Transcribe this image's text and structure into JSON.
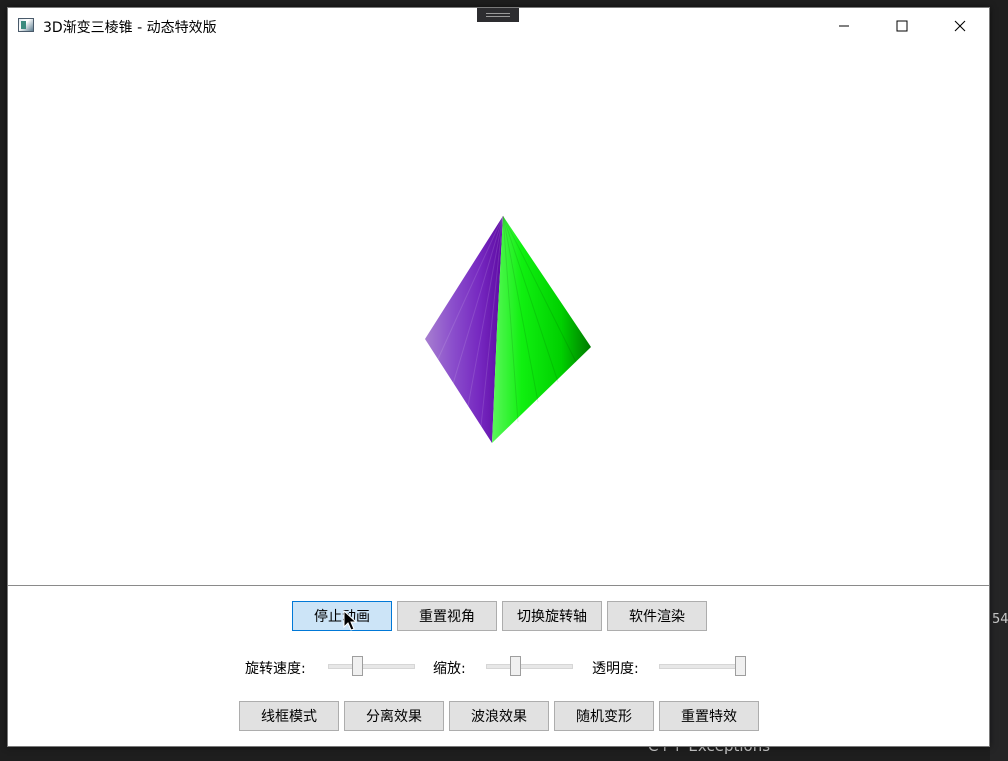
{
  "window": {
    "title": "3D渐变三棱锥 - 动态特效版"
  },
  "background": {
    "bottom_text": "C++ Exceptions",
    "side_number": "54"
  },
  "buttons_row1": [
    {
      "label": "停止动画",
      "active": true
    },
    {
      "label": "重置视角"
    },
    {
      "label": "切换旋转轴"
    },
    {
      "label": "软件渲染"
    }
  ],
  "sliders": [
    {
      "label": "旋转速度:",
      "value": 0.3
    },
    {
      "label": "缩放:",
      "value": 0.3
    },
    {
      "label": "透明度:",
      "value": 1.0
    }
  ],
  "buttons_row2": [
    {
      "label": "线框模式"
    },
    {
      "label": "分离效果"
    },
    {
      "label": "波浪效果"
    },
    {
      "label": "随机变形"
    },
    {
      "label": "重置特效"
    }
  ],
  "colors": {
    "purple_face": "#7a2fc0",
    "green_face": "#1fe81f",
    "button_active": "#cce4f7",
    "button_active_border": "#0078d7"
  }
}
